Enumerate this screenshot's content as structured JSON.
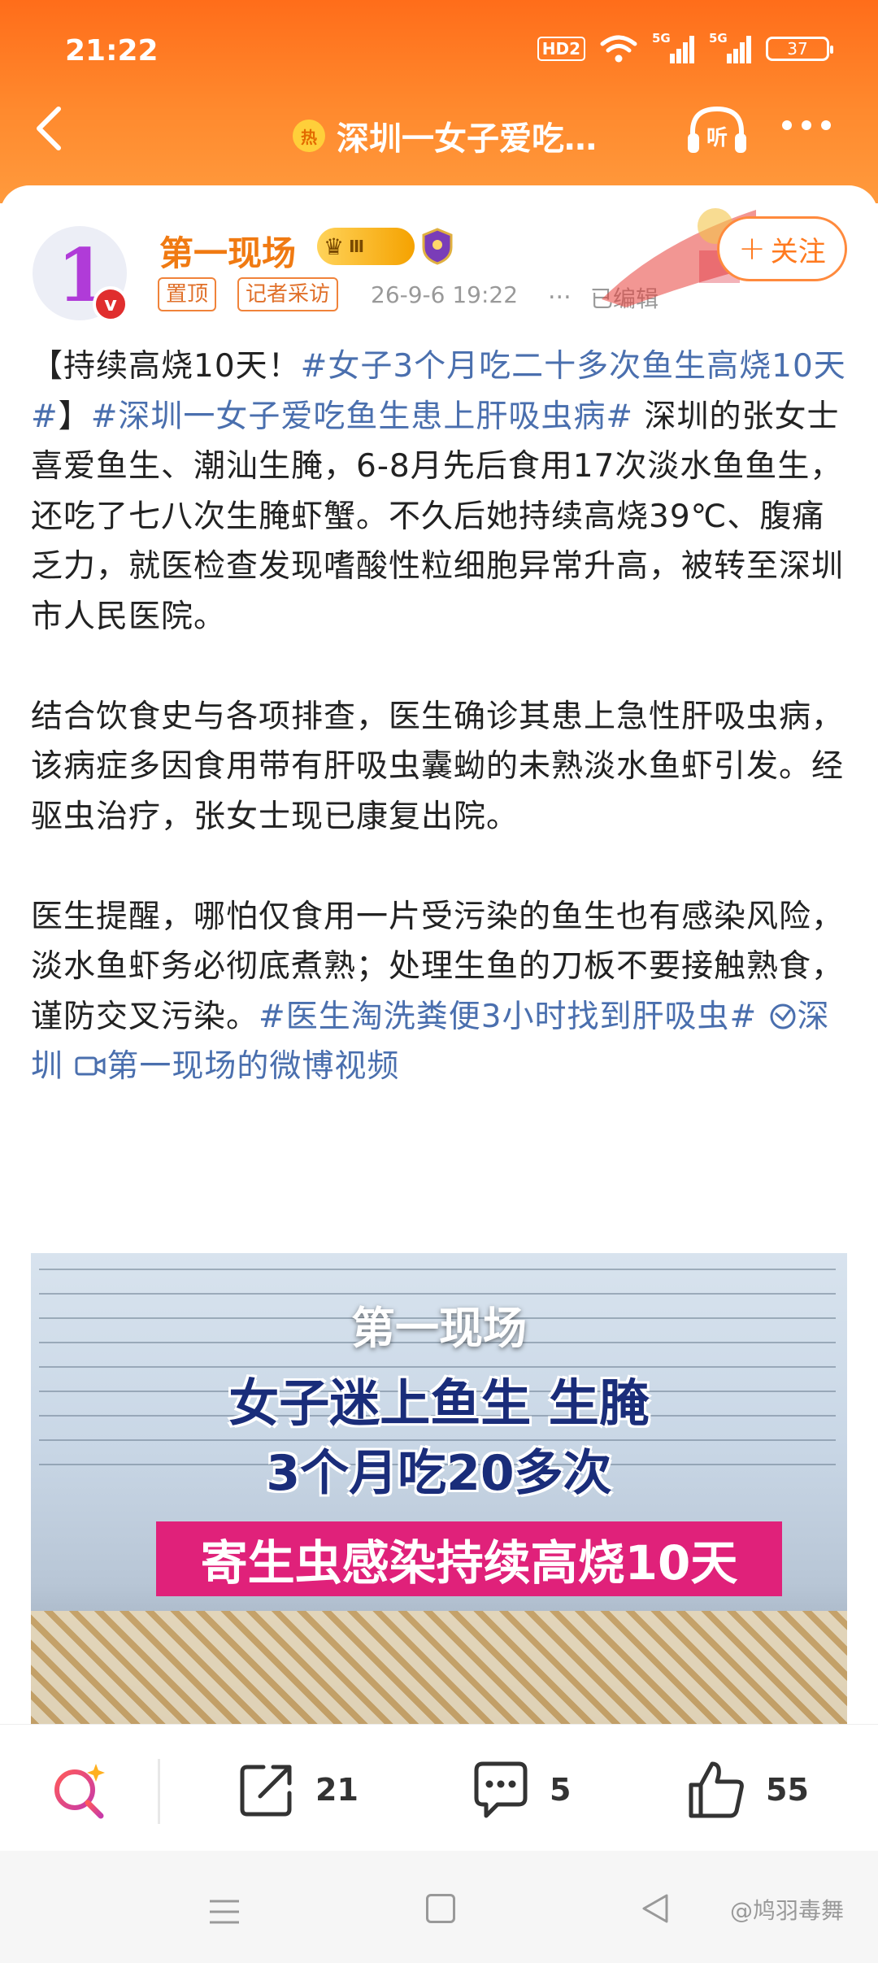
{
  "status_bar": {
    "time": "21:22",
    "hd": "HD2",
    "signal_1": "5G",
    "signal_2": "5G",
    "battery": "37"
  },
  "nav": {
    "hot_badge": "热",
    "title": "深圳一女子爱吃…",
    "listen_label": "听"
  },
  "post": {
    "author": "第一现场",
    "level_badge": "Ⅲ",
    "verified_mark": "v",
    "tag_pinned": "置顶",
    "tag_reporter": "记者采访",
    "time": "26-9-6 19:22",
    "dots": "...",
    "edited": "已编辑",
    "follow_label": "关注",
    "follow_plus": "+",
    "text": {
      "p1_a": "【持续高烧10天！",
      "p1_topic1": "#女子3个月吃二十多次鱼生高烧10天#",
      "p1_b": "】",
      "p1_topic2": "#深圳一女子爱吃鱼生患上肝吸虫病#",
      "p1_c": " 深圳的张女士喜爱鱼生、潮汕生腌，6-8月先后食用17次淡水鱼鱼生，还吃了七八次生腌虾蟹。不久后她持续高烧39℃、腹痛乏力，就医检查发现嗜酸性粒细胞异常升高，被转至深圳市人民医院。",
      "p2": "结合饮食史与各项排查，医生确诊其患上急性肝吸虫病，该病症多因食用带有肝吸虫囊蚴的未熟淡水鱼虾引发。经驱虫治疗，张女士现已康复出院。",
      "p3_a": "医生提醒，哪怕仅食用一片受污染的鱼生也有感染风险，淡水鱼虾务必彻底煮熟；处理生鱼的刀板不要接触熟食，谨防交叉污染。",
      "p3_topic": "#医生淘洗粪便3小时找到肝吸虫#",
      "p3_location": "深圳",
      "p3_video": "第一现场的微博视频"
    },
    "video": {
      "brand": "第一现场",
      "line1": "女子迷上鱼生 生腌",
      "line2": "3个月吃20多次",
      "banner": "寄生虫感染持续高烧10天"
    }
  },
  "actions": {
    "repost_count": "21",
    "comment_count": "5",
    "like_count": "55"
  },
  "watermark": "@鸠羽毒舞",
  "colors": {
    "header": "#ff7a22",
    "topic": "#4a6fae",
    "author": "#f07a12",
    "banner": "#e0217a"
  }
}
